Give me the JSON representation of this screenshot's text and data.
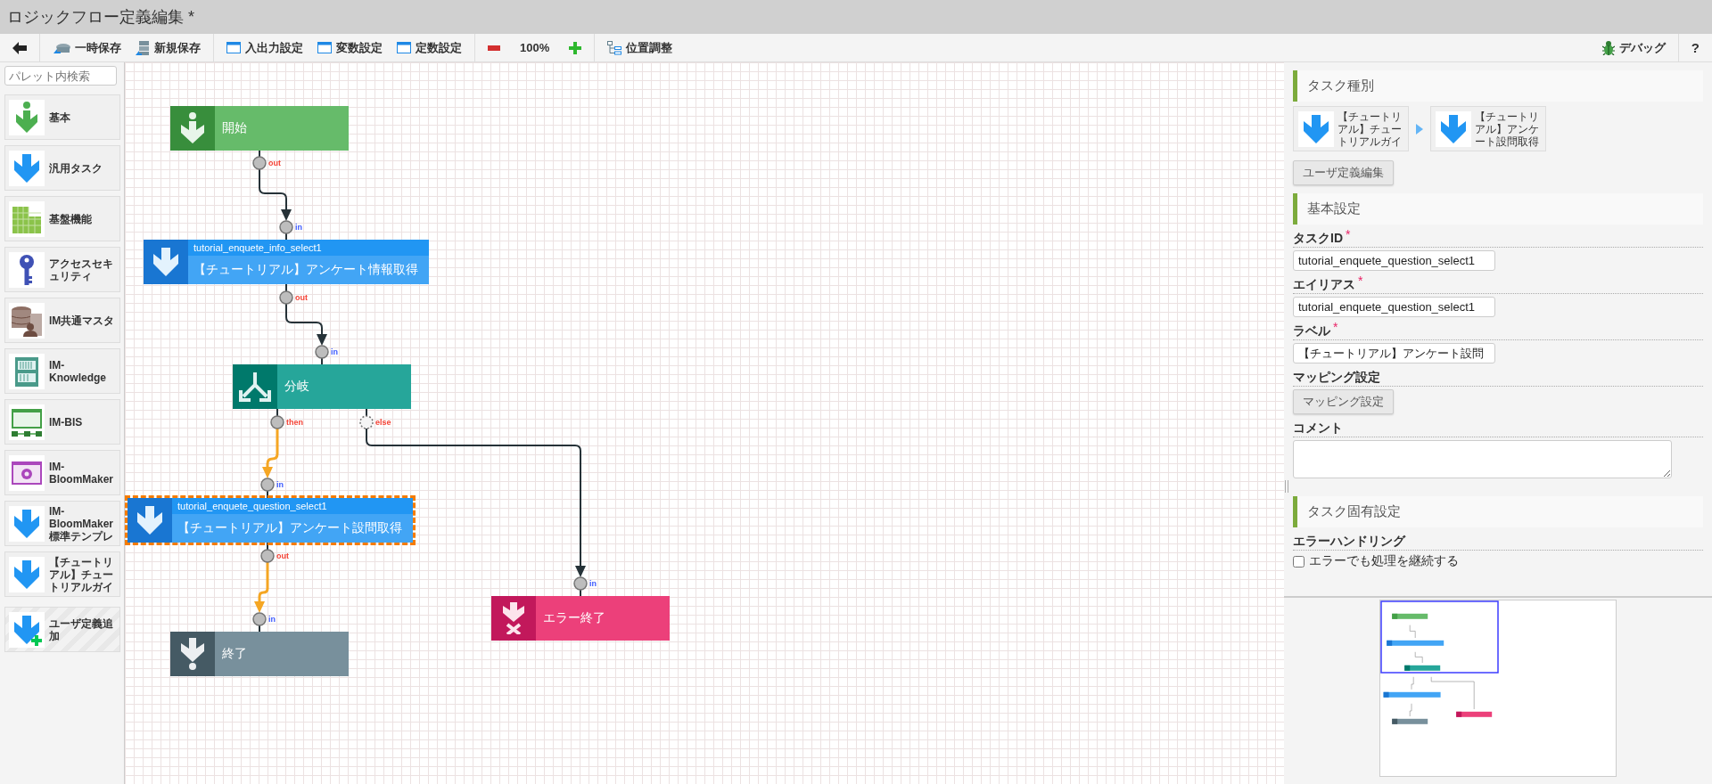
{
  "window": {
    "title": "ロジックフロー定義編集 *"
  },
  "toolbar": {
    "groups": [
      [
        {
          "kind": "back"
        }
      ],
      [
        {
          "kind": "tempsave",
          "label": "一時保存"
        },
        {
          "kind": "newsave",
          "label": "新規保存"
        }
      ],
      [
        {
          "kind": "dialog",
          "label": "入出力設定"
        },
        {
          "kind": "dialog",
          "label": "変数設定"
        },
        {
          "kind": "dialog",
          "label": "定数設定"
        }
      ],
      [
        {
          "kind": "zoomout"
        },
        {
          "kind": "zoomlevel",
          "label": "100%"
        },
        {
          "kind": "zoomin"
        }
      ],
      [
        {
          "kind": "layout",
          "label": "位置調整"
        }
      ]
    ],
    "right": [
      {
        "kind": "debug",
        "label": "デバッグ"
      },
      {
        "kind": "help",
        "label": "?"
      }
    ]
  },
  "palette": {
    "search": {
      "placeholder": "パレット内検索"
    },
    "items": [
      {
        "kind": "basic",
        "label": "基本"
      },
      {
        "kind": "task",
        "label": "汎用タスク"
      },
      {
        "kind": "platform",
        "label": "基盤機能"
      },
      {
        "kind": "key",
        "label": "アクセスセキュリティ"
      },
      {
        "kind": "master",
        "label": "IM共通マスタ"
      },
      {
        "kind": "knowledge",
        "label": "IM-Knowledge"
      },
      {
        "kind": "bis",
        "label": "IM-BIS"
      },
      {
        "kind": "bloom",
        "label": "IM-BloomMaker"
      },
      {
        "kind": "task",
        "label": "IM-BloomMaker標準テンプレ"
      },
      {
        "kind": "task",
        "label": "【チュートリアル】チュートリアルガイ"
      },
      {
        "kind": "add",
        "label": "ユーザ定義追加"
      }
    ]
  },
  "canvas": {
    "nodes": [
      {
        "kind": "start",
        "label": "開始",
        "selected": false,
        "ports": [
          {
            "label": "out",
            "kind": "solid"
          }
        ]
      },
      {
        "kind": "task",
        "id": "tutorial_enquete_info_select1",
        "label": "【チュートリアル】アンケート情報取得",
        "selected": false,
        "ports": [
          {
            "label": "in",
            "kind": "solid"
          },
          {
            "label": "out",
            "kind": "solid"
          }
        ]
      },
      {
        "kind": "branch",
        "label": "分岐",
        "selected": false,
        "ports": [
          {
            "label": "in",
            "kind": "solid"
          },
          {
            "label": "then",
            "kind": "solid"
          },
          {
            "label": "else",
            "kind": "dotted"
          }
        ]
      },
      {
        "kind": "task",
        "id": "tutorial_enquete_question_select1",
        "label": "【チュートリアル】アンケート設問取得",
        "selected": true,
        "ports": [
          {
            "label": "in",
            "kind": "solid"
          },
          {
            "label": "out",
            "kind": "solid"
          }
        ]
      },
      {
        "kind": "end",
        "label": "終了",
        "selected": false,
        "ports": [
          {
            "label": "in",
            "kind": "solid"
          }
        ]
      },
      {
        "kind": "error",
        "label": "エラー終了",
        "selected": false,
        "ports": [
          {
            "label": "in",
            "kind": "solid"
          }
        ]
      }
    ],
    "edges": [
      {
        "highlighted": false
      },
      {
        "highlighted": false
      },
      {
        "highlighted": true
      },
      {
        "highlighted": false
      },
      {
        "highlighted": true
      }
    ]
  },
  "task_type": {
    "heading": "タスク種別",
    "path": [
      {
        "label": "【チュートリアル】チュートリアルガイ"
      },
      {
        "label": "【チュートリアル】アンケート設問取得"
      }
    ],
    "edit_button": "ユーザ定義編集"
  },
  "basic_settings": {
    "heading": "基本設定",
    "fields": [
      {
        "kind": "text",
        "label": "タスクID",
        "required_mark": "*",
        "value": "tutorial_enquete_question_select1"
      },
      {
        "kind": "text",
        "label": "エイリアス",
        "required_mark": "*",
        "value": "tutorial_enquete_question_select1"
      },
      {
        "kind": "text",
        "label": "ラベル",
        "required_mark": "*",
        "value": "【チュートリアル】アンケート設問"
      },
      {
        "kind": "button",
        "label": "マッピング設定",
        "button": "マッピング設定"
      },
      {
        "kind": "textarea",
        "label": "コメント"
      }
    ]
  },
  "task_settings": {
    "heading": "タスク固有設定",
    "fields": [
      {
        "kind": "checkbox",
        "label": "エラーハンドリング",
        "option": "エラーでも処理を継続する",
        "checked": false
      }
    ]
  }
}
